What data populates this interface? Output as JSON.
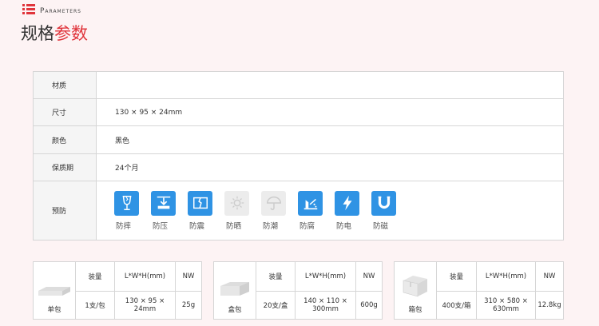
{
  "header": {
    "en": "Parameters",
    "title_a": "规格",
    "title_b": "参数"
  },
  "specs": {
    "material": {
      "key": "材质",
      "value": ""
    },
    "size": {
      "key": "尺寸",
      "value": "130 × 95 × 24mm"
    },
    "color": {
      "key": "颜色",
      "value": "黑色"
    },
    "shelf": {
      "key": "保质期",
      "value": "24个月"
    },
    "protect": {
      "key": "预防"
    }
  },
  "features": [
    {
      "label": "防摔",
      "icon": "fragile-icon",
      "active": true
    },
    {
      "label": "防压",
      "icon": "press-icon",
      "active": true
    },
    {
      "label": "防震",
      "icon": "shock-icon",
      "active": true
    },
    {
      "label": "防晒",
      "icon": "sun-icon",
      "active": false
    },
    {
      "label": "防潮",
      "icon": "umbrella-icon",
      "active": false
    },
    {
      "label": "防腐",
      "icon": "corrosion-icon",
      "active": true
    },
    {
      "label": "防电",
      "icon": "lightning-icon",
      "active": true
    },
    {
      "label": "防磁",
      "icon": "magnet-icon",
      "active": true
    }
  ],
  "packages": [
    {
      "name": "单包",
      "h_qty": "装量",
      "h_dim": "L*W*H(mm)",
      "h_nw": "NW",
      "qty": "1支/包",
      "dim": "130 × 95 × 24mm",
      "nw": "25g"
    },
    {
      "name": "盒包",
      "h_qty": "装量",
      "h_dim": "L*W*H(mm)",
      "h_nw": "NW",
      "qty": "20支/盒",
      "dim": "140 × 110 × 300mm",
      "nw": "600g"
    },
    {
      "name": "箱包",
      "h_qty": "装量",
      "h_dim": "L*W*H(mm)",
      "h_nw": "NW",
      "qty": "400支/箱",
      "dim": "310 × 580 × 630mm",
      "nw": "12.8kg"
    }
  ],
  "colors": {
    "accent": "#e0343b",
    "icon_blue": "#2f93e4",
    "icon_off": "#ececec"
  }
}
